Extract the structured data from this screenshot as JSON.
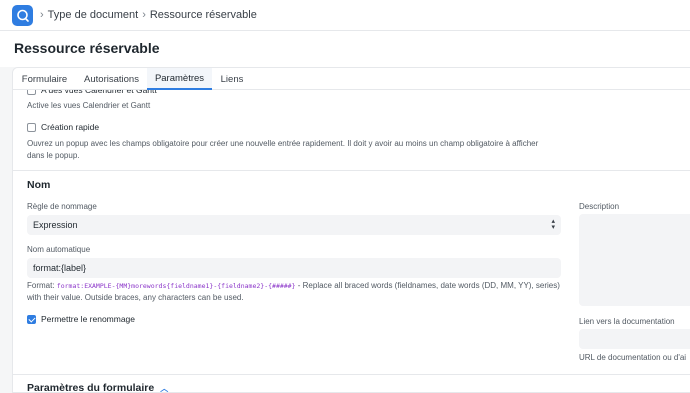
{
  "breadcrumb": {
    "items": [
      "Type de document",
      "Ressource réservable"
    ]
  },
  "page": {
    "title": "Ressource réservable"
  },
  "tabs": [
    "Formulaire",
    "Autorisations",
    "Paramètres",
    "Liens"
  ],
  "active_tab": "Paramètres",
  "settings": {
    "calendar_label": "A des vues Calendrier et Gantt",
    "calendar_desc": "Active les vues Calendrier et Gantt",
    "quick_entry_label": "Création rapide",
    "quick_entry_checked": false,
    "quick_entry_desc": "Ouvrez un popup avec les champs obligatoire pour créer une nouvelle entrée rapidement. Il doit y avoir au moins un champ obligatoire à afficher dans le popup."
  },
  "naming": {
    "section_title": "Nom",
    "rule_label": "Règle de nommage",
    "rule_value": "Expression",
    "autoname_label": "Nom automatique",
    "autoname_value": "format:{label}",
    "format_prefix": "Format:",
    "format_code": "format:EXAMPLE-{MM}morewords{fieldname1}-{fieldname2}-{#####}",
    "format_desc": "- Replace all braced words (fieldnames, date words (DD, MM, YY), series) with their value. Outside braces, any characters can be used.",
    "allow_rename_label": "Permettre le renommage",
    "allow_rename_checked": true,
    "description_label": "Description",
    "doc_link_label": "Lien vers la documentation",
    "doc_url_label": "URL de documentation ou d'ai"
  },
  "form_settings": {
    "section_title": "Paramètres du formulaire"
  },
  "colors": {
    "accent": "#2f7de1",
    "code": "#8b35c9"
  }
}
